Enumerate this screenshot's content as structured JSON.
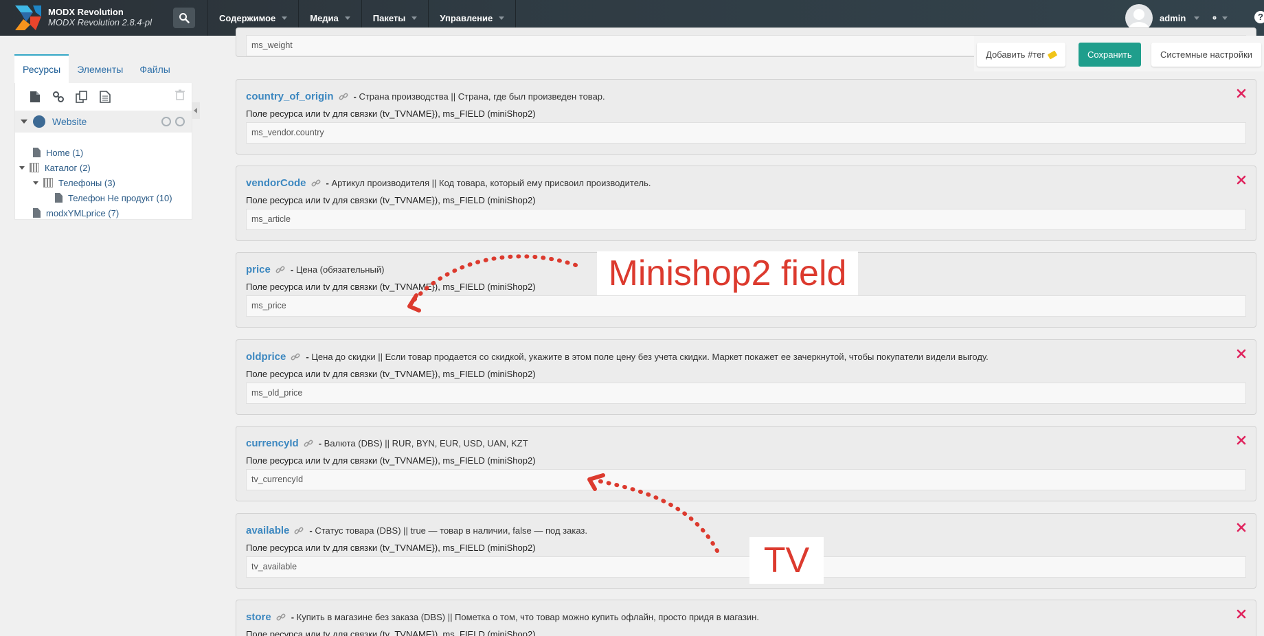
{
  "app": {
    "name": "MODX Revolution",
    "version": "MODX Revolution 2.8.4-pl"
  },
  "nav": [
    "Содержимое",
    "Медиа",
    "Пакеты",
    "Управление"
  ],
  "user": {
    "name": "admin"
  },
  "left_panel": {
    "tabs": [
      "Ресурсы",
      "Элементы",
      "Файлы"
    ],
    "context": "Website",
    "tree": [
      {
        "label": "Home (1)"
      },
      {
        "label": "Каталог (2)"
      },
      {
        "label": "Телефоны (3)"
      },
      {
        "label": "Телефон Не продукт (10)"
      },
      {
        "label": "modxYMLprice (7)"
      }
    ]
  },
  "toolbar": {
    "add_tag": "Добавить #тег",
    "save": "Сохранить",
    "system_settings": "Системные настройки"
  },
  "hint_text": "Поле ресурса или tv для связки (tv_TVNAME}), ms_FIELD (miniShop2)",
  "fields": [
    {
      "name": "",
      "desc": "",
      "value": "ms_weight"
    },
    {
      "name": "country_of_origin",
      "desc": "Страна производства || Страна, где был произведен товар.",
      "value": "ms_vendor.country"
    },
    {
      "name": "vendorCode",
      "desc": "Артикул производителя || Код товара, который ему присвоил производитель.",
      "value": "ms_article"
    },
    {
      "name": "price",
      "desc": "Цена (обязательный)",
      "value": "ms_price"
    },
    {
      "name": "oldprice",
      "desc": "Цена до скидки || Если товар продается со скидкой, укажите в этом поле цену без учета скидки. Маркет покажет ее зачеркнутой, чтобы покупатели видели выгоду.",
      "value": "ms_old_price"
    },
    {
      "name": "currencyId",
      "desc": "Валюта (DBS) || RUR, BYN, EUR, USD, UAN, KZT",
      "value": "tv_currencyId"
    },
    {
      "name": "available",
      "desc": "Статус товара (DBS) || true — товар в наличии, false — под заказ.",
      "value": "tv_available"
    },
    {
      "name": "store",
      "desc": "Купить в магазине без заказа (DBS) || Пометка о том, что товар можно купить офлайн, просто придя в магазин.",
      "value": ""
    }
  ],
  "annotations": {
    "minishop": "Minishop2 field",
    "tv": "TV",
    "color": "#dc3a2e"
  },
  "colors": {
    "accent": "#1f9e8c",
    "link": "#3d88c0",
    "delete": "#e0245e"
  }
}
